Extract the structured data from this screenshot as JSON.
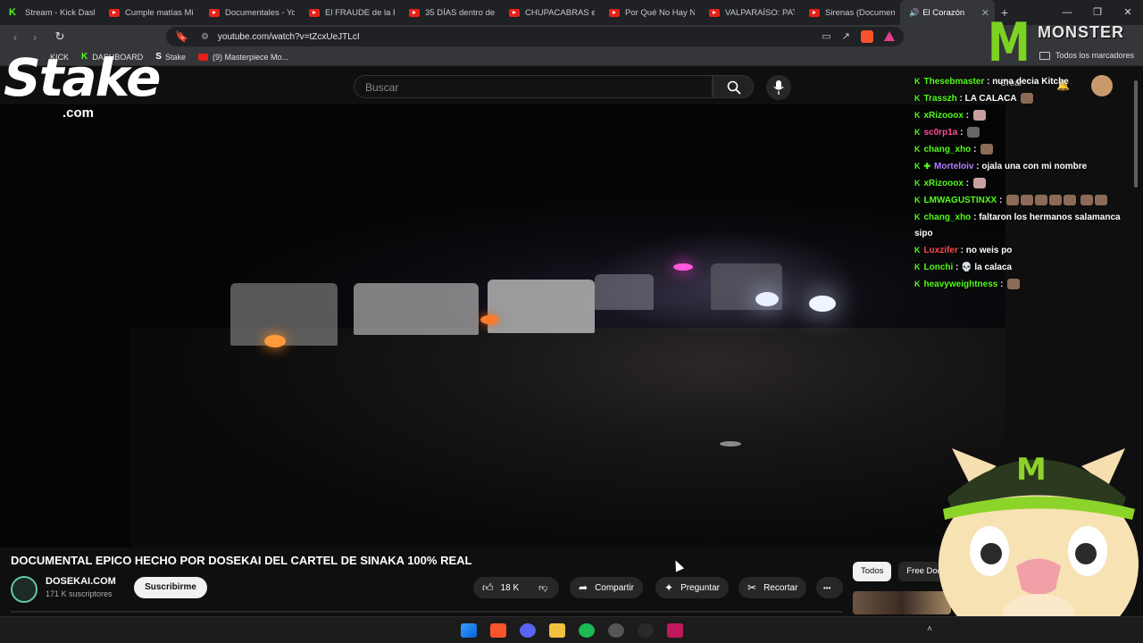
{
  "browser": {
    "tabs": [
      {
        "label": "Stream - Kick Dash",
        "icon": "kick-icon"
      },
      {
        "label": "Cumple matías Mi",
        "icon": "youtube-icon"
      },
      {
        "label": "Documentales - Yo",
        "icon": "youtube-icon"
      },
      {
        "label": "El FRAUDE de la FI",
        "icon": "youtube-icon"
      },
      {
        "label": "35 DÍAS dentro de",
        "icon": "youtube-icon"
      },
      {
        "label": "CHUPACABRAS en",
        "icon": "youtube-icon"
      },
      {
        "label": "Por Qué No Hay N",
        "icon": "youtube-icon"
      },
      {
        "label": "VALPARAÍSO: PATR",
        "icon": "youtube-icon"
      },
      {
        "label": "Sirenas (Documen",
        "icon": "youtube-icon"
      }
    ],
    "active_tab": {
      "label": "El Corazón",
      "close": "✕"
    },
    "new_tab": "+",
    "url": "youtube.com/watch?v=tZcxUeJTLcI",
    "bookmarks": [
      {
        "label": "KICK",
        "icon": "kick-icon"
      },
      {
        "label": "DASHBOARD",
        "icon": "kick-icon"
      },
      {
        "label": "Stake",
        "icon": "stake-icon"
      },
      {
        "label": "(9) Masterpiece Mo...",
        "icon": "youtube-icon"
      }
    ],
    "all_bookmarks": "Todos los marcadores"
  },
  "youtube": {
    "search_placeholder": "Buscar",
    "create_label": "Crear",
    "video_title": "DOCUMENTAL EPICO HECHO POR DOSEKAI DEL CARTEL DE SINAKA 100% REAL",
    "channel": {
      "name": "DOSEKAI.COM",
      "subscribers": "171 K suscriptores"
    },
    "subscribe_label": "Suscribirme",
    "actions": {
      "likes": "18 K",
      "share": "Compartir",
      "ask": "Preguntar",
      "clip": "Recortar",
      "more": "•••"
    },
    "chips": [
      "Todos",
      "Free Doc"
    ]
  },
  "overlay": {
    "stake_logo": "Stake",
    "stake_domain": ".com",
    "monster_logo": "MONSTER",
    "chat": [
      {
        "user": "Thesebmaster",
        "color": "#53fc18",
        "text": "nuna decia Kitche"
      },
      {
        "user": "Trasszh",
        "color": "#53fc18",
        "text": "LA CALACA"
      },
      {
        "user": "xRizooox",
        "color": "#53fc18",
        "text": ""
      },
      {
        "user": "sc0rp1a",
        "color": "#ff4f9a",
        "text": ""
      },
      {
        "user": "chang_xho",
        "color": "#53fc18",
        "text": ""
      },
      {
        "user": "Morteloiv",
        "color": "#b57bff",
        "text": "ojala una con mi nombre"
      },
      {
        "user": "xRizooox",
        "color": "#53fc18",
        "text": ""
      },
      {
        "user": "LMWAGUSTINXX",
        "color": "#53fc18",
        "text": ""
      },
      {
        "user": "chang_xho",
        "color": "#53fc18",
        "text": "faltaron los hermanos salamanca sipo"
      },
      {
        "user": "Luxzifer",
        "color": "#ff4a4a",
        "text": "no weis po"
      },
      {
        "user": "Lonchi",
        "color": "#53fc18",
        "text": "la calaca"
      },
      {
        "user": "heavyweightness",
        "color": "#53fc18",
        "text": ""
      }
    ]
  },
  "colors": {
    "kick": "#53fc18",
    "youtube_red": "#e62117",
    "monster_green": "#7cd321"
  }
}
